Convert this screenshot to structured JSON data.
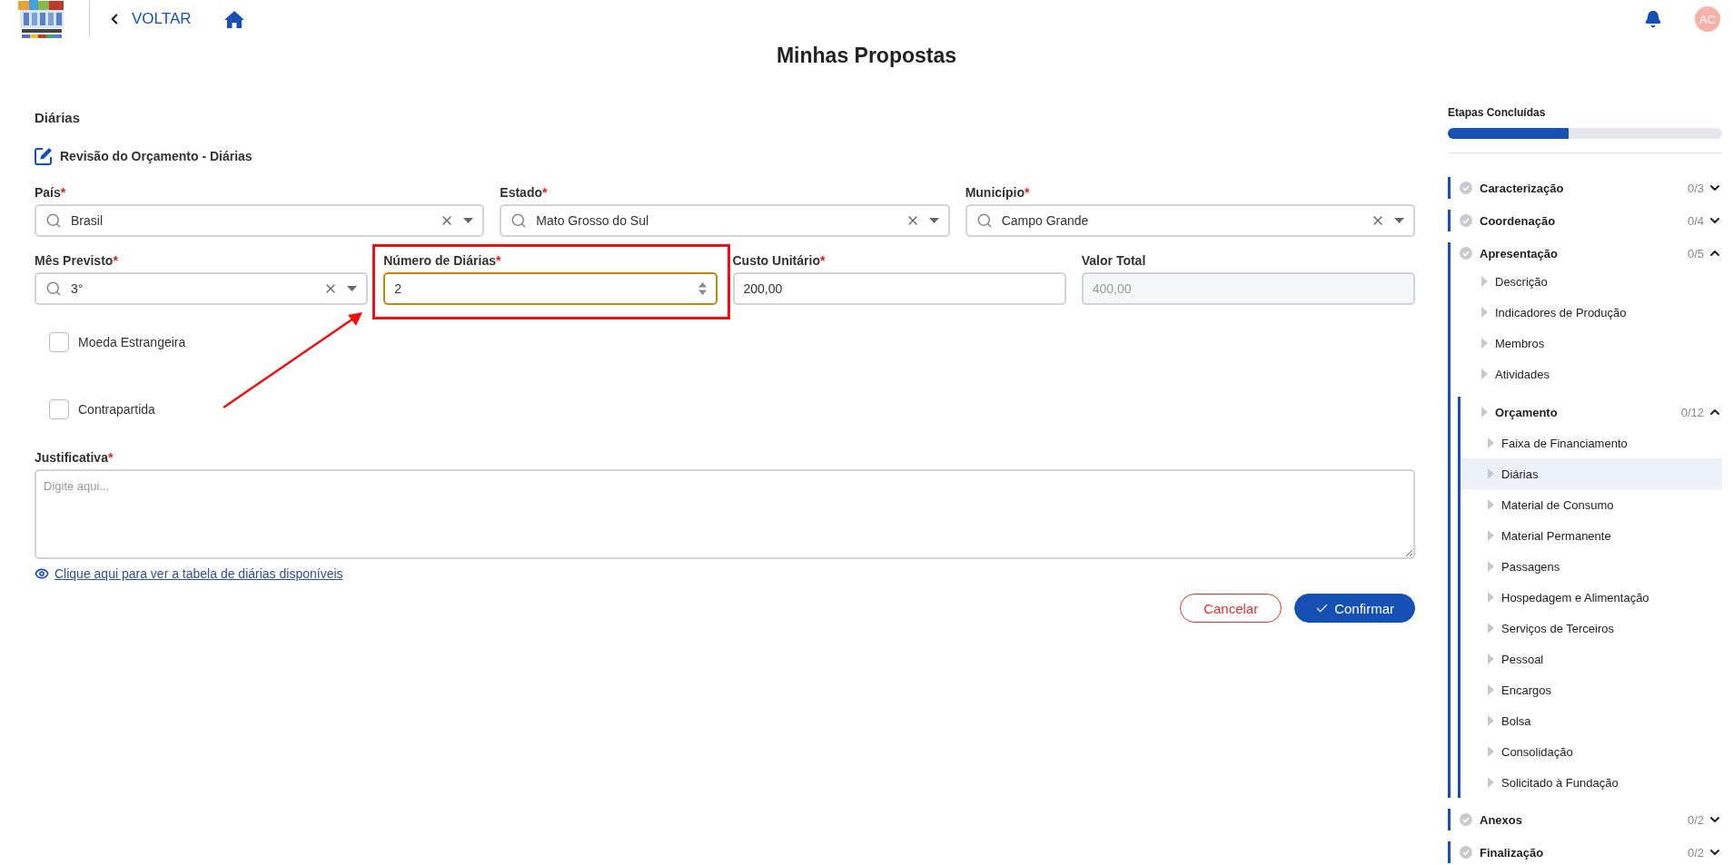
{
  "header": {
    "back_label": "VOLTAR",
    "avatar": "AC"
  },
  "page_title": "Minhas Propostas",
  "form": {
    "section_title": "Diárias",
    "subtitle": "Revisão do Orçamento - Diárias",
    "rows": [
      [
        {
          "label": "País",
          "required_mark": "*",
          "kind": "select",
          "value": "Brasil",
          "focused": false
        },
        {
          "label": "Estado",
          "required_mark": "*",
          "kind": "select",
          "value": "Mato Grosso do Sul",
          "focused": false
        },
        {
          "label": "Município",
          "required_mark": "*",
          "kind": "select",
          "value": "Campo Grande",
          "focused": false
        }
      ],
      [
        {
          "label": "Mês Previsto",
          "required_mark": "*",
          "kind": "select",
          "value": "3°",
          "focused": false
        },
        {
          "label": "Número de Diárias",
          "required_mark": "*",
          "kind": "number",
          "value": "2",
          "focused": true,
          "highlighted": true
        },
        {
          "label": "Custo Unitário",
          "required_mark": "*",
          "kind": "text",
          "value": "200,00",
          "focused": false
        },
        {
          "label": "Valor Total",
          "kind": "readonly",
          "value": "400,00",
          "focused": false
        }
      ]
    ],
    "checkboxes": [
      {
        "label": "Moeda Estrangeira",
        "checked": false
      },
      {
        "label": "Contrapartida",
        "checked": false
      }
    ],
    "justification": {
      "label": "Justificativa",
      "required_mark": "*",
      "placeholder": "Digite aqui..."
    },
    "link": "Clique aqui para ver a tabela de diárias disponíveis",
    "buttons": [
      {
        "label": "Cancelar",
        "kind": "secondary"
      },
      {
        "label": "Confirmar",
        "kind": "primary"
      }
    ]
  },
  "sidebar": {
    "title": "Etapas Concluídas",
    "level": 0.44,
    "sections": [
      {
        "label": "Caracterização",
        "count": "0/3",
        "expanded": false
      },
      {
        "label": "Coordenação",
        "count": "0/4",
        "expanded": false
      },
      {
        "label": "Apresentação",
        "count": "0/5",
        "expanded": true,
        "children": [
          {
            "label": "Descrição",
            "selected": false
          },
          {
            "label": "Indicadores de Produção",
            "selected": false
          },
          {
            "label": "Membros",
            "selected": false
          },
          {
            "label": "Atividades",
            "selected": false
          },
          {
            "label": "Orçamento",
            "count": "0/12",
            "expanded": true,
            "selected": false,
            "children": [
              {
                "label": "Faixa de Financiamento",
                "selected": false
              },
              {
                "label": "Diárias",
                "selected": true
              },
              {
                "label": "Material de Consumo",
                "selected": false
              },
              {
                "label": "Material Permanente",
                "selected": false
              },
              {
                "label": "Passagens",
                "selected": false
              },
              {
                "label": "Hospedagem e Alimentação",
                "selected": false
              },
              {
                "label": "Serviços de Terceiros",
                "selected": false
              },
              {
                "label": "Pessoal",
                "selected": false
              },
              {
                "label": "Encargos",
                "selected": false
              },
              {
                "label": "Bolsa",
                "selected": false
              },
              {
                "label": "Consolidação",
                "selected": false
              },
              {
                "label": "Solicitado à Fundação",
                "selected": false
              }
            ]
          }
        ]
      },
      {
        "label": "Anexos",
        "count": "0/2",
        "expanded": false
      },
      {
        "label": "Finalização",
        "count": "0/2",
        "expanded": false
      }
    ]
  }
}
